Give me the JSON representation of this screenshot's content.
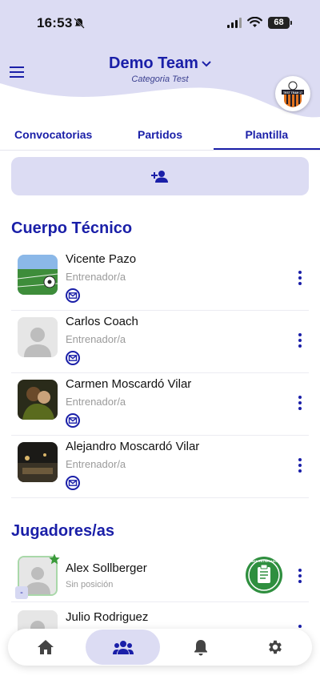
{
  "status_bar": {
    "time": "16:53",
    "battery": "68"
  },
  "header": {
    "team_name": "Demo Team",
    "category": "Categoria Test",
    "badge_text": "TEST TEAM 17"
  },
  "tabs": [
    {
      "label": "Convocatorias"
    },
    {
      "label": "Partidos"
    },
    {
      "label": "Plantilla",
      "active": true
    }
  ],
  "sections": {
    "staff_title": "Cuerpo Técnico",
    "players_title": "Jugadores/as"
  },
  "staff": [
    {
      "name": "Vicente Pazo",
      "role": "Entrenador/a",
      "avatar": "photo-soccer-field"
    },
    {
      "name": "Carlos Coach",
      "role": "Entrenador/a",
      "avatar": "placeholder-person"
    },
    {
      "name": "Carmen Moscardó Vilar",
      "role": "Entrenador/a",
      "avatar": "photo-people"
    },
    {
      "name": "Alejandro Moscardó Vilar",
      "role": "Entrenador/a",
      "avatar": "photo-night"
    }
  ],
  "players": [
    {
      "name": "Alex Sollberger",
      "position": "Sin posición",
      "number": "-",
      "badge": "BIEN ENTRENADO"
    },
    {
      "name": "Julio Rodriguez"
    }
  ],
  "colors": {
    "brand": "#1a1fa8",
    "header_bg": "#dcdcf3",
    "star": "#3a9a3a",
    "badge_green": "#2f8f3f"
  },
  "icons": [
    "menu-icon",
    "chevron-down-icon",
    "add-person-icon",
    "mail-icon",
    "more-vert-icon",
    "home-icon",
    "team-icon",
    "bell-icon",
    "gear-icon",
    "star-icon"
  ]
}
